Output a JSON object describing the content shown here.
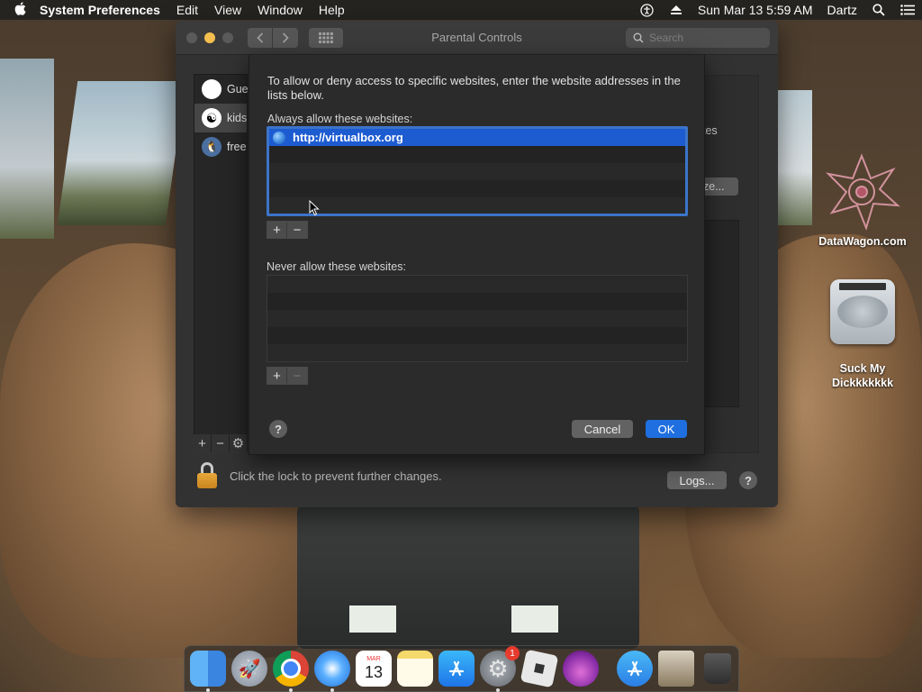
{
  "menubar": {
    "app_name": "System Preferences",
    "menus": [
      "Edit",
      "View",
      "Window",
      "Help"
    ],
    "datetime": "Sun Mar 13  5:59 AM",
    "user": "Dartz"
  },
  "window": {
    "title": "Parental Controls",
    "search_placeholder": "Search",
    "users": [
      {
        "name": "Gue"
      },
      {
        "name": "kids"
      },
      {
        "name": "free"
      }
    ],
    "right_text": "tes",
    "right_button": "ze...",
    "lock_text": "Click the lock to prevent further changes.",
    "logs_label": "Logs...",
    "help_label": "?"
  },
  "sheet": {
    "intro": "To allow or deny access to specific websites, enter the website addresses in the lists below.",
    "allow_label": "Always allow these websites:",
    "allowed_sites": [
      "http://virtualbox.org"
    ],
    "never_label": "Never allow these websites:",
    "plus": "+",
    "minus": "−",
    "help_label": "?",
    "cancel_label": "Cancel",
    "ok_label": "OK"
  },
  "desktop": {
    "logo_label": "DataWagon.com",
    "disk_label": "Suck My Dickkkkkkk"
  },
  "dock": {
    "calendar_month": "MAR",
    "calendar_day": "13",
    "syspref_badge": "1"
  },
  "colors": {
    "accent": "#1d5bd1",
    "ok_button": "#1f6fe0",
    "window_bg": "#323232"
  }
}
